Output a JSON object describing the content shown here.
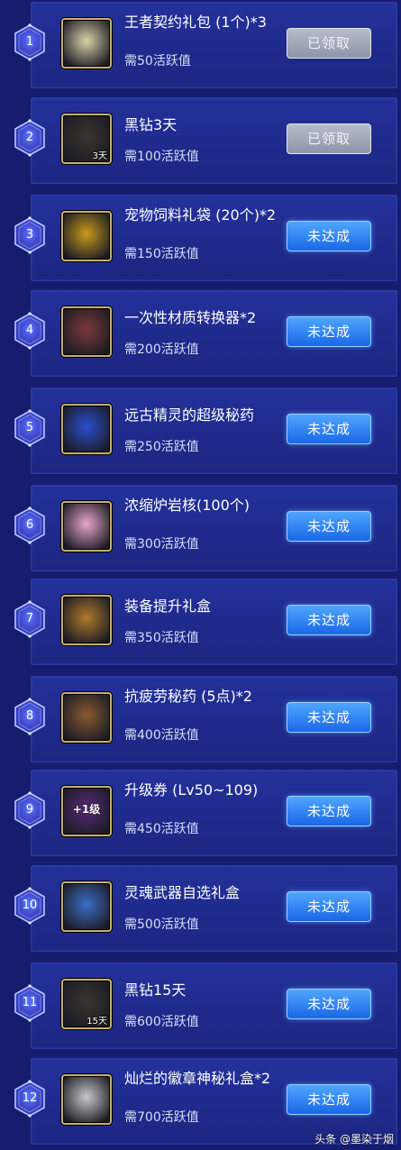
{
  "items": [
    {
      "num": "1",
      "name": "王者契约礼包 (1个)*3",
      "req": "需50活跃值",
      "status": "已领取",
      "claimed": true,
      "corner": "",
      "icon": "contract-package-icon",
      "icon_color": "#d7d2a8"
    },
    {
      "num": "2",
      "name": "黑钻3天",
      "req": "需100活跃值",
      "status": "已领取",
      "claimed": true,
      "corner": "3天",
      "icon": "black-diamond-helmet-icon",
      "icon_color": "#3a3530"
    },
    {
      "num": "3",
      "name": "宠物饲料礼袋 (20个)*2",
      "req": "需150活跃值",
      "status": "未达成",
      "claimed": false,
      "corner": "",
      "icon": "pet-food-bag-icon",
      "icon_color": "#c99a1a"
    },
    {
      "num": "4",
      "name": "一次性材质转换器*2",
      "req": "需200活跃值",
      "status": "未达成",
      "claimed": false,
      "corner": "",
      "icon": "material-converter-icon",
      "icon_color": "#7a3a3a"
    },
    {
      "num": "5",
      "name": "远古精灵的超级秘药",
      "req": "需250活跃值",
      "status": "未达成",
      "claimed": false,
      "corner": "",
      "icon": "elixir-bottle-icon",
      "icon_color": "#2a4fd0"
    },
    {
      "num": "6",
      "name": "浓缩炉岩核(100个)",
      "req": "需300活跃值",
      "status": "未达成",
      "claimed": false,
      "corner": "",
      "icon": "pink-box-icon",
      "icon_color": "#e7a6c9"
    },
    {
      "num": "7",
      "name": "装备提升礼盒",
      "req": "需350活跃值",
      "status": "未达成",
      "claimed": false,
      "corner": "",
      "icon": "treasure-chest-icon",
      "icon_color": "#b07a2a"
    },
    {
      "num": "8",
      "name": "抗疲劳秘药 (5点)*2",
      "req": "需400活跃值",
      "status": "未达成",
      "claimed": false,
      "corner": "",
      "icon": "potion-jar-icon",
      "icon_color": "#8a5a30"
    },
    {
      "num": "9",
      "name": "升级券 (Lv50~109)",
      "req": "需450活跃值",
      "status": "未达成",
      "claimed": false,
      "corner": "",
      "icon": "level-up-ticket-icon",
      "icon_color": "#5a2a7a",
      "icon_text": "+1级"
    },
    {
      "num": "10",
      "name": "灵魂武器自选礼盒",
      "req": "需500活跃值",
      "status": "未达成",
      "claimed": false,
      "corner": "",
      "icon": "soul-weapon-box-icon",
      "icon_color": "#3b6fc9"
    },
    {
      "num": "11",
      "name": "黑钻15天",
      "req": "需600活跃值",
      "status": "未达成",
      "claimed": false,
      "corner": "15天",
      "icon": "black-diamond-helmet-icon",
      "icon_color": "#3a3530"
    },
    {
      "num": "12",
      "name": "灿烂的徽章神秘礼盒*2",
      "req": "需700活跃值",
      "status": "未达成",
      "claimed": false,
      "corner": "",
      "icon": "mystery-emblem-box-icon",
      "icon_color": "#c8c8c8"
    }
  ],
  "watermark": "头条 @墨染于烟"
}
